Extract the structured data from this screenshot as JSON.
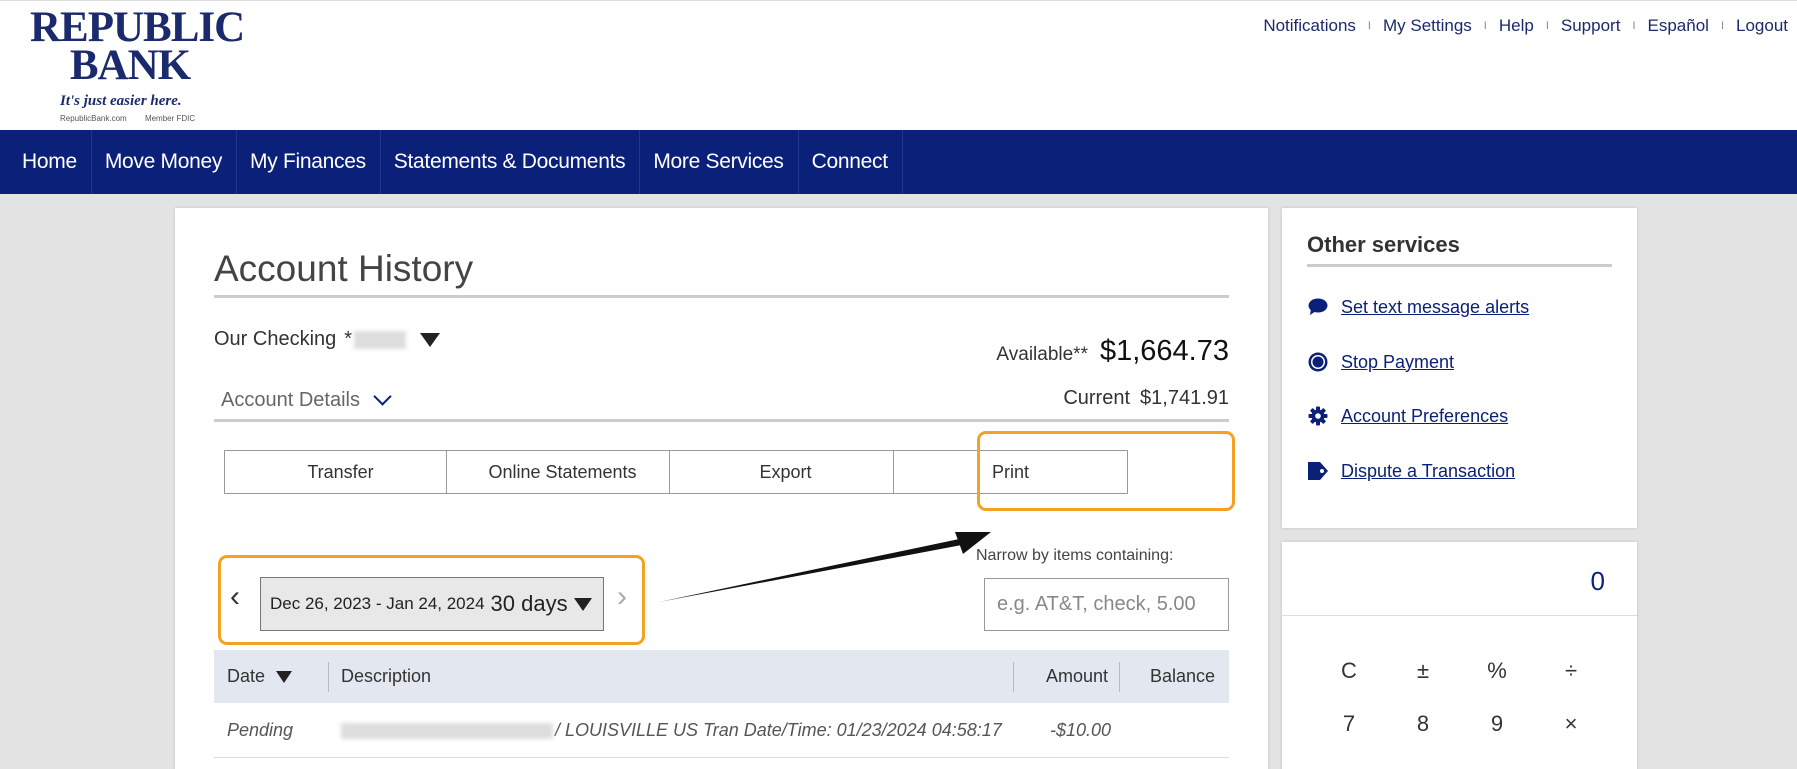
{
  "header": {
    "logo": {
      "line1": "REPUBLIC",
      "line2": "BANK",
      "tagline": "It's just easier here.",
      "site": "RepublicBank.com",
      "member": "Member FDIC"
    },
    "links": [
      "Notifications",
      "My Settings",
      "Help",
      "Support",
      "Español",
      "Logout"
    ]
  },
  "nav": [
    "Home",
    "Move Money",
    "My Finances",
    "Statements & Documents",
    "More Services",
    "Connect"
  ],
  "main": {
    "title": "Account History",
    "account_name": "Our Checking",
    "account_mask_prefix": "*",
    "available_label": "Available**",
    "available_value": "$1,664.73",
    "details_label": "Account Details",
    "current_label": "Current",
    "current_value": "$1,741.91",
    "buttons": {
      "transfer": "Transfer",
      "statements": "Online Statements",
      "export": "Export",
      "print": "Print"
    },
    "date_range": {
      "range": "Dec 26, 2023 - Jan 24, 2024",
      "days": "30 days",
      "prev": "‹",
      "next": "›"
    },
    "narrow": {
      "label": "Narrow by items containing:",
      "placeholder": "e.g. AT&T, check, 5.00"
    },
    "table": {
      "headers": {
        "date": "Date",
        "description": "Description",
        "amount": "Amount",
        "balance": "Balance"
      },
      "rows": [
        {
          "date": "Pending",
          "description": "/ LOUISVILLE US Tran Date/Time: 01/23/2024 04:58:17",
          "amount": "-$10.00",
          "balance": ""
        }
      ]
    }
  },
  "side": {
    "title": "Other services",
    "services": [
      {
        "label": "Set text message alerts",
        "icon": "chat-bubble-icon"
      },
      {
        "label": "Stop Payment",
        "icon": "stop-circle-icon"
      },
      {
        "label": "Account Preferences",
        "icon": "gear-icon"
      },
      {
        "label": "Dispute a Transaction",
        "icon": "tag-icon"
      }
    ]
  },
  "calculator": {
    "display": "0",
    "keys_row1": [
      "C",
      "±",
      "%",
      "÷"
    ],
    "keys_row2": [
      "7",
      "8",
      "9",
      "×"
    ]
  },
  "colors": {
    "brand": "#0b2079",
    "highlight": "#f3a224",
    "logo": "#1a2a6c"
  }
}
